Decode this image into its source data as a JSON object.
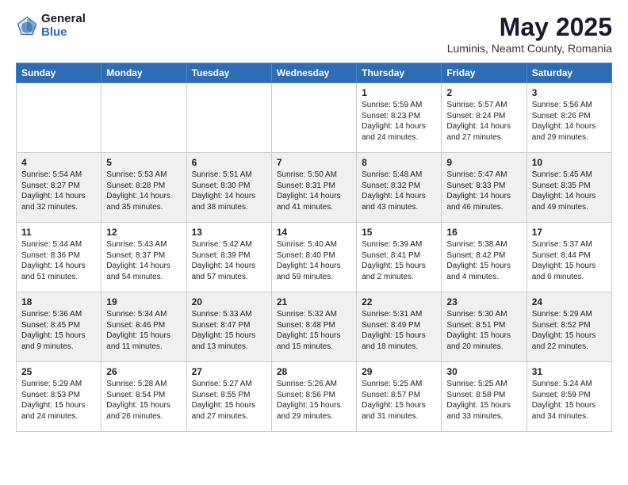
{
  "logo": {
    "general": "General",
    "blue": "Blue"
  },
  "title": "May 2025",
  "subtitle": "Luminis, Neamt County, Romania",
  "weekdays": [
    "Sunday",
    "Monday",
    "Tuesday",
    "Wednesday",
    "Thursday",
    "Friday",
    "Saturday"
  ],
  "weeks": [
    [
      {
        "day": "",
        "info": ""
      },
      {
        "day": "",
        "info": ""
      },
      {
        "day": "",
        "info": ""
      },
      {
        "day": "",
        "info": ""
      },
      {
        "day": "1",
        "info": "Sunrise: 5:59 AM\nSunset: 8:23 PM\nDaylight: 14 hours\nand 24 minutes."
      },
      {
        "day": "2",
        "info": "Sunrise: 5:57 AM\nSunset: 8:24 PM\nDaylight: 14 hours\nand 27 minutes."
      },
      {
        "day": "3",
        "info": "Sunrise: 5:56 AM\nSunset: 8:26 PM\nDaylight: 14 hours\nand 29 minutes."
      }
    ],
    [
      {
        "day": "4",
        "info": "Sunrise: 5:54 AM\nSunset: 8:27 PM\nDaylight: 14 hours\nand 32 minutes."
      },
      {
        "day": "5",
        "info": "Sunrise: 5:53 AM\nSunset: 8:28 PM\nDaylight: 14 hours\nand 35 minutes."
      },
      {
        "day": "6",
        "info": "Sunrise: 5:51 AM\nSunset: 8:30 PM\nDaylight: 14 hours\nand 38 minutes."
      },
      {
        "day": "7",
        "info": "Sunrise: 5:50 AM\nSunset: 8:31 PM\nDaylight: 14 hours\nand 41 minutes."
      },
      {
        "day": "8",
        "info": "Sunrise: 5:48 AM\nSunset: 8:32 PM\nDaylight: 14 hours\nand 43 minutes."
      },
      {
        "day": "9",
        "info": "Sunrise: 5:47 AM\nSunset: 8:33 PM\nDaylight: 14 hours\nand 46 minutes."
      },
      {
        "day": "10",
        "info": "Sunrise: 5:45 AM\nSunset: 8:35 PM\nDaylight: 14 hours\nand 49 minutes."
      }
    ],
    [
      {
        "day": "11",
        "info": "Sunrise: 5:44 AM\nSunset: 8:36 PM\nDaylight: 14 hours\nand 51 minutes."
      },
      {
        "day": "12",
        "info": "Sunrise: 5:43 AM\nSunset: 8:37 PM\nDaylight: 14 hours\nand 54 minutes."
      },
      {
        "day": "13",
        "info": "Sunrise: 5:42 AM\nSunset: 8:39 PM\nDaylight: 14 hours\nand 57 minutes."
      },
      {
        "day": "14",
        "info": "Sunrise: 5:40 AM\nSunset: 8:40 PM\nDaylight: 14 hours\nand 59 minutes."
      },
      {
        "day": "15",
        "info": "Sunrise: 5:39 AM\nSunset: 8:41 PM\nDaylight: 15 hours\nand 2 minutes."
      },
      {
        "day": "16",
        "info": "Sunrise: 5:38 AM\nSunset: 8:42 PM\nDaylight: 15 hours\nand 4 minutes."
      },
      {
        "day": "17",
        "info": "Sunrise: 5:37 AM\nSunset: 8:44 PM\nDaylight: 15 hours\nand 6 minutes."
      }
    ],
    [
      {
        "day": "18",
        "info": "Sunrise: 5:36 AM\nSunset: 8:45 PM\nDaylight: 15 hours\nand 9 minutes."
      },
      {
        "day": "19",
        "info": "Sunrise: 5:34 AM\nSunset: 8:46 PM\nDaylight: 15 hours\nand 11 minutes."
      },
      {
        "day": "20",
        "info": "Sunrise: 5:33 AM\nSunset: 8:47 PM\nDaylight: 15 hours\nand 13 minutes."
      },
      {
        "day": "21",
        "info": "Sunrise: 5:32 AM\nSunset: 8:48 PM\nDaylight: 15 hours\nand 15 minutes."
      },
      {
        "day": "22",
        "info": "Sunrise: 5:31 AM\nSunset: 8:49 PM\nDaylight: 15 hours\nand 18 minutes."
      },
      {
        "day": "23",
        "info": "Sunrise: 5:30 AM\nSunset: 8:51 PM\nDaylight: 15 hours\nand 20 minutes."
      },
      {
        "day": "24",
        "info": "Sunrise: 5:29 AM\nSunset: 8:52 PM\nDaylight: 15 hours\nand 22 minutes."
      }
    ],
    [
      {
        "day": "25",
        "info": "Sunrise: 5:29 AM\nSunset: 8:53 PM\nDaylight: 15 hours\nand 24 minutes."
      },
      {
        "day": "26",
        "info": "Sunrise: 5:28 AM\nSunset: 8:54 PM\nDaylight: 15 hours\nand 26 minutes."
      },
      {
        "day": "27",
        "info": "Sunrise: 5:27 AM\nSunset: 8:55 PM\nDaylight: 15 hours\nand 27 minutes."
      },
      {
        "day": "28",
        "info": "Sunrise: 5:26 AM\nSunset: 8:56 PM\nDaylight: 15 hours\nand 29 minutes."
      },
      {
        "day": "29",
        "info": "Sunrise: 5:25 AM\nSunset: 8:57 PM\nDaylight: 15 hours\nand 31 minutes."
      },
      {
        "day": "30",
        "info": "Sunrise: 5:25 AM\nSunset: 8:58 PM\nDaylight: 15 hours\nand 33 minutes."
      },
      {
        "day": "31",
        "info": "Sunrise: 5:24 AM\nSunset: 8:59 PM\nDaylight: 15 hours\nand 34 minutes."
      }
    ]
  ]
}
